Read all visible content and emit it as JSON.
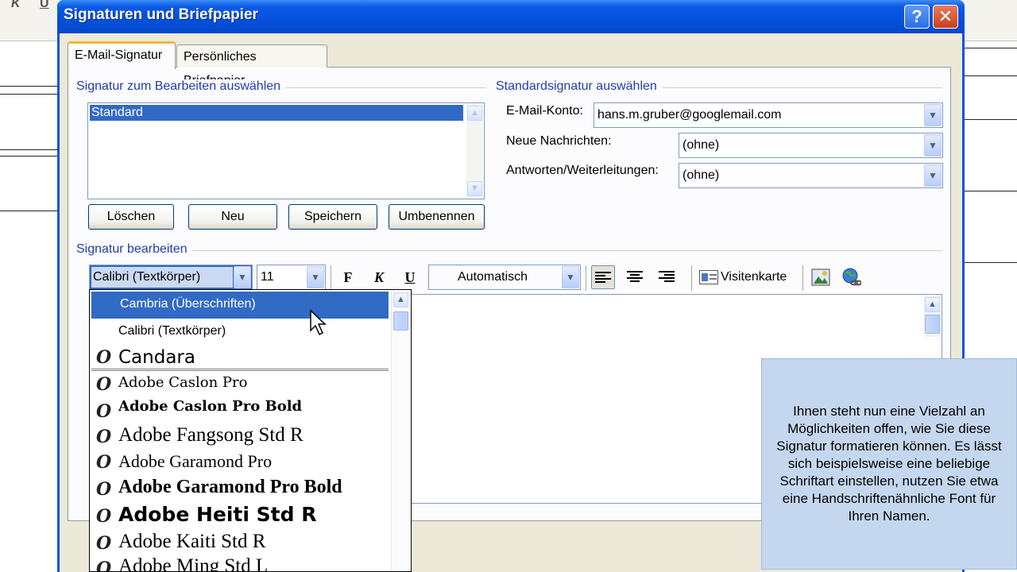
{
  "background_doc": {
    "toolbar_glyphs": [
      "K",
      "U"
    ]
  },
  "dialog": {
    "title": "Signaturen und Briefpapier",
    "help_label": "?",
    "close_label": "✕"
  },
  "tabs": [
    {
      "label": "E-Mail-Signatur",
      "active": true
    },
    {
      "label": "Persönliches Briefpapier",
      "active": false
    }
  ],
  "signature_select": {
    "group_label": "Signatur zum Bearbeiten auswählen",
    "items": [
      "Standard"
    ],
    "selected": "Standard",
    "buttons": {
      "delete": "Löschen",
      "new": "Neu",
      "save": "Speichern",
      "rename": "Umbenennen"
    }
  },
  "default_signature": {
    "group_label": "Standardsignatur auswählen",
    "account_label": "E-Mail-Konto:",
    "account_value": "hans.m.gruber@googlemail.com",
    "new_messages_label": "Neue Nachrichten:",
    "new_messages_value": "(ohne)",
    "replies_label": "Antworten/Weiterleitungen:",
    "replies_value": "(ohne)"
  },
  "edit_signature": {
    "group_label": "Signatur bearbeiten",
    "font_value": "Calibri (Textkörper)",
    "size_value": "11",
    "bold_label": "F",
    "italic_label": "K",
    "underline_label": "U",
    "color_value": "Automatisch",
    "business_card_label": "Visitenkarte"
  },
  "font_dropdown": {
    "theme_fonts": [
      {
        "name": "Cambria (Überschriften)",
        "selected": true
      },
      {
        "name": "Calibri (Textkörper)",
        "selected": false
      }
    ],
    "recent_fonts": [
      "Candara"
    ],
    "all_fonts": [
      "Adobe Caslon Pro",
      "Adobe Caslon Pro Bold",
      "Adobe Fangsong Std R",
      "Adobe Garamond Pro",
      "Adobe Garamond Pro Bold",
      "Adobe Heiti Std R",
      "Adobe Kaiti Std R",
      "Adobe Ming Std L"
    ],
    "opentype_marker": "O"
  },
  "info_box": {
    "text": "Ihnen steht nun eine Vielzahl an Möglichkeiten offen, wie Sie diese Signatur formatieren können. Es lässt sich beispielsweise eine beliebige Schriftart einstellen, nutzen Sie etwa eine Handschriftenähnliche Font für Ihren Namen."
  }
}
